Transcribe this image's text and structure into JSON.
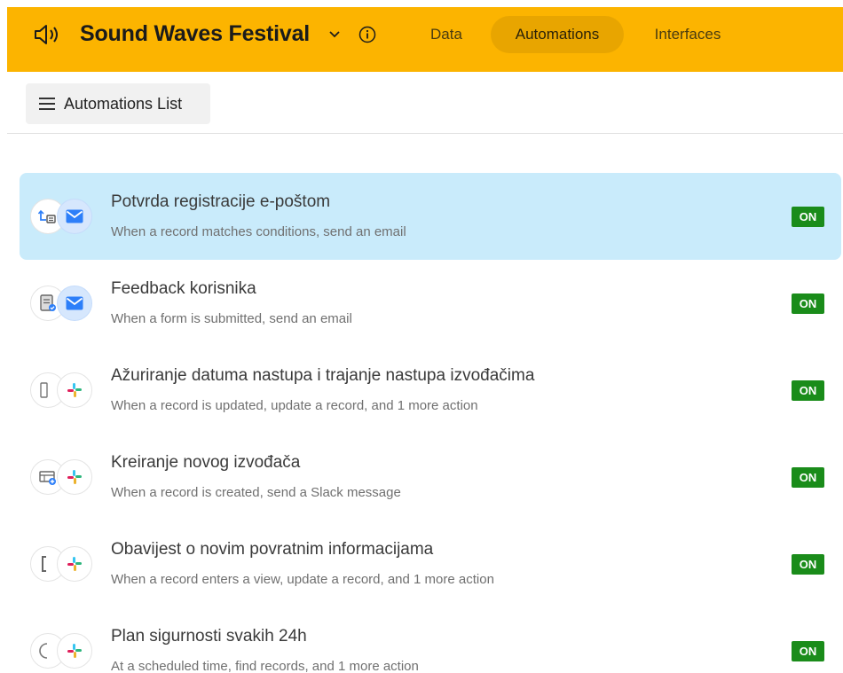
{
  "header": {
    "base_name": "Sound Waves Festival",
    "logo_icon": "speaker-icon",
    "background_color": "#fcb400",
    "nav": [
      {
        "label": "Data",
        "selected": false
      },
      {
        "label": "Automations",
        "selected": true
      },
      {
        "label": "Interfaces",
        "selected": false
      }
    ]
  },
  "toolbar": {
    "list_button_label": "Automations List",
    "list_button_icon": "hamburger-menu-icon"
  },
  "automations": [
    {
      "title": "Potvrda registracije e-poštom",
      "description": "When a record matches conditions, send an email",
      "status": "ON",
      "trigger_icon": "matches-conditions-icon",
      "action_icon": "email-icon",
      "selected": true
    },
    {
      "title": "Feedback korisnika",
      "description": "When a form is submitted, send an email",
      "status": "ON",
      "trigger_icon": "form-submitted-icon",
      "action_icon": "email-icon",
      "selected": false
    },
    {
      "title": "Ažuriranje datuma nastupa i trajanje nastupa izvođačima",
      "description": "When a record is updated, update a record, and 1 more action",
      "status": "ON",
      "trigger_icon": "record-updated-icon",
      "action_icon": "slack-icon",
      "selected": false
    },
    {
      "title": "Kreiranje novog izvođača",
      "description": "When a record is created, send a Slack message",
      "status": "ON",
      "trigger_icon": "record-created-icon",
      "action_icon": "slack-icon",
      "selected": false
    },
    {
      "title": "Obavijest o novim povratnim informacijama",
      "description": "When a record enters a view, update a record, and 1 more action",
      "status": "ON",
      "trigger_icon": "record-enters-view-icon",
      "action_icon": "slack-icon",
      "selected": false
    },
    {
      "title": "Plan sigurnosti svakih 24h",
      "description": "At a scheduled time, find records, and 1 more action",
      "status": "ON",
      "trigger_icon": "scheduled-time-icon",
      "action_icon": "slack-icon",
      "selected": false
    }
  ],
  "colors": {
    "selected_row": "#c9ebfb",
    "on_badge": "#1a8c1a",
    "email_icon": "#2d7ff9"
  }
}
